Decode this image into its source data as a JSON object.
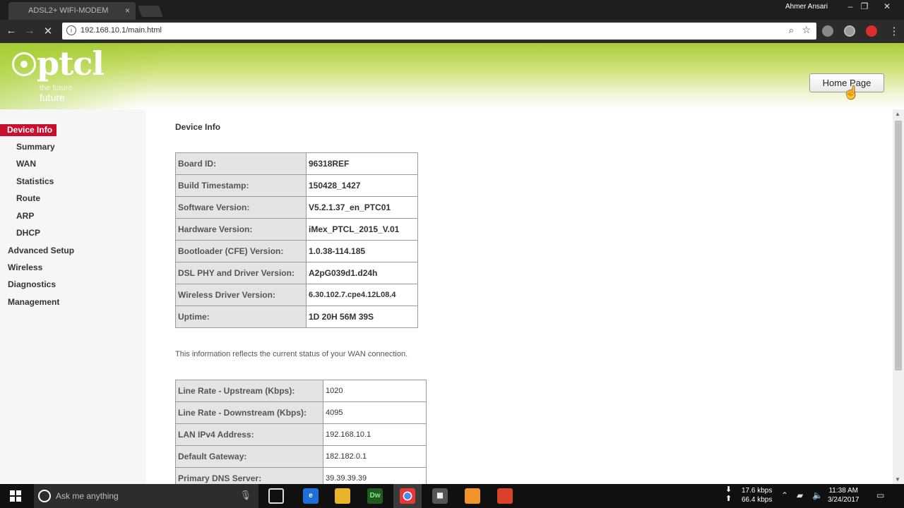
{
  "browser": {
    "tab_title": "ADSL2+ WIFI-MODEM",
    "tab_close": "×",
    "user": "Ahmer Ansari",
    "url": "192.168.10.1/main.html"
  },
  "header": {
    "logo_text": "ptcl",
    "logo_tagline_1": "the future",
    "logo_tagline_2": "future",
    "home_button": "Home Page"
  },
  "sidebar": {
    "items": [
      {
        "label": "Device Info",
        "active": true
      },
      {
        "label": "Summary"
      },
      {
        "label": "WAN"
      },
      {
        "label": "Statistics"
      },
      {
        "label": "Route"
      },
      {
        "label": "ARP"
      },
      {
        "label": "DHCP"
      },
      {
        "label": "Advanced Setup"
      },
      {
        "label": "Wireless"
      },
      {
        "label": "Diagnostics"
      },
      {
        "label": "Management"
      }
    ]
  },
  "main": {
    "title": "Device Info",
    "device_table": [
      {
        "key": "Board ID:",
        "value": "96318REF"
      },
      {
        "key": "Build Timestamp:",
        "value": "150428_1427"
      },
      {
        "key": "Software Version:",
        "value": "V5.2.1.37_en_PTC01"
      },
      {
        "key": "Hardware Version:",
        "value": "iMex_PTCL_2015_V.01"
      },
      {
        "key": "Bootloader (CFE) Version:",
        "value": "1.0.38-114.185"
      },
      {
        "key": "DSL PHY and Driver Version:",
        "value": "A2pG039d1.d24h"
      },
      {
        "key": "Wireless Driver Version:",
        "value": "6.30.102.7.cpe4.12L08.4"
      },
      {
        "key": "Uptime:",
        "value": "1D 20H 56M 39S"
      }
    ],
    "note": "This information reflects the current status of your WAN connection.",
    "wan_table": [
      {
        "key": "Line Rate - Upstream (Kbps):",
        "value": "1020"
      },
      {
        "key": "Line Rate - Downstream (Kbps):",
        "value": "4095"
      },
      {
        "key": "LAN IPv4 Address:",
        "value": "192.168.10.1"
      },
      {
        "key": "Default Gateway:",
        "value": "182.182.0.1"
      },
      {
        "key": "Primary DNS Server:",
        "value": "39.39.39.39"
      }
    ]
  },
  "taskbar": {
    "search_placeholder": "Ask me anything",
    "upload_speed": "17.6 kbps",
    "download_speed": "66.4 kbps",
    "time": "11:38 AM",
    "date": "3/24/2017"
  },
  "colors": {
    "active_menu": "#c8102e",
    "header_green": "#a9cc3a"
  }
}
